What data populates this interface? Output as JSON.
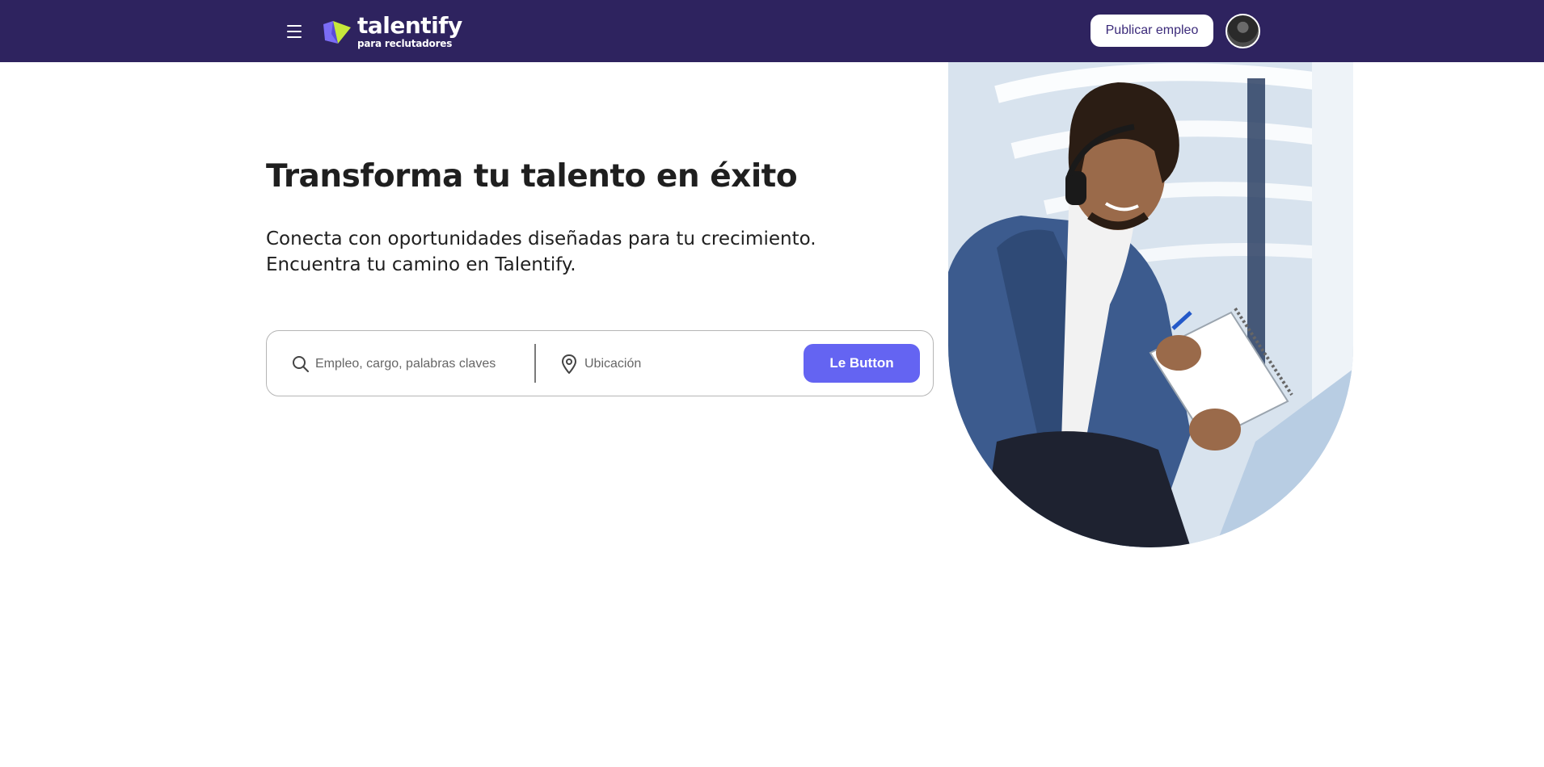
{
  "header": {
    "menu_icon": "hamburger-menu-icon",
    "logo": {
      "name": "talentify",
      "subtitle": "para reclutadores"
    },
    "publish_label": "Publicar empleo",
    "avatar_icon": "user-avatar"
  },
  "hero": {
    "title": "Transforma tu talento en éxito",
    "subtitle_line1": "Conecta con oportunidades diseñadas para tu crecimiento.",
    "subtitle_line2": "Encuentra tu camino en Talentify."
  },
  "search": {
    "keyword_icon": "search-icon",
    "keyword_placeholder": "Empleo, cargo, palabras claves",
    "keyword_value": "",
    "location_icon": "location-pin-icon",
    "location_placeholder": "Ubicación",
    "location_value": "",
    "button_label": "Le Button"
  },
  "colors": {
    "header_bg": "#2e235f",
    "primary_button": "#6464f2",
    "text": "#1f1f1f"
  }
}
